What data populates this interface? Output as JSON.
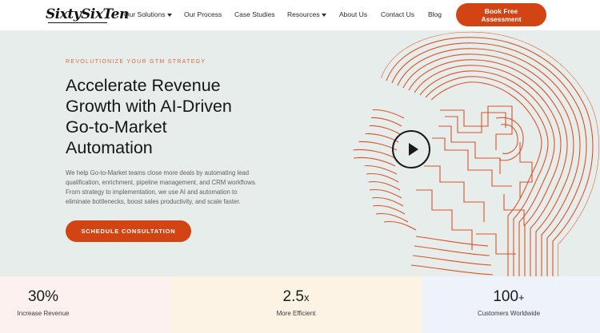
{
  "brand": {
    "logo_text": "SixtySixTen"
  },
  "nav": {
    "items": [
      {
        "label": "Our Solutions",
        "dropdown": true
      },
      {
        "label": "Our Process",
        "dropdown": false
      },
      {
        "label": "Case Studies",
        "dropdown": false
      },
      {
        "label": "Resources",
        "dropdown": true
      },
      {
        "label": "About Us",
        "dropdown": false
      },
      {
        "label": "Contact Us",
        "dropdown": false
      },
      {
        "label": "Blog",
        "dropdown": false
      }
    ],
    "cta_line1": "Book Free",
    "cta_line2": "Assessment"
  },
  "hero": {
    "eyebrow": "REVOLUTIONIZE YOUR GTM STRATEGY",
    "headline_lines": [
      "Accelerate Revenue",
      "Growth with AI-Driven",
      "Go-to-Market",
      "Automation"
    ],
    "description_lines": [
      "We help Go-to-Market teams close more deals by automating lead",
      "qualification, enrichment, pipeline management, and CRM workflows.",
      "From strategy to implementation, we use AI and automation to",
      "eliminate bottlenecks, boost sales productivity, and scale faster."
    ],
    "cta_label": "SCHEDULE CONSULTATION",
    "media": {
      "icon": "play-icon"
    }
  },
  "stats": [
    {
      "value": "30%",
      "suffix": "",
      "label": "Increase Revenue"
    },
    {
      "value": "2.5",
      "suffix": "x",
      "label": "More Efficient"
    },
    {
      "value": "100",
      "suffix": "+",
      "label": "Customers Worldwide"
    }
  ],
  "colors": {
    "accent": "#d34414",
    "hero_bg": "#e7edea",
    "art_line": "#d9532a"
  }
}
